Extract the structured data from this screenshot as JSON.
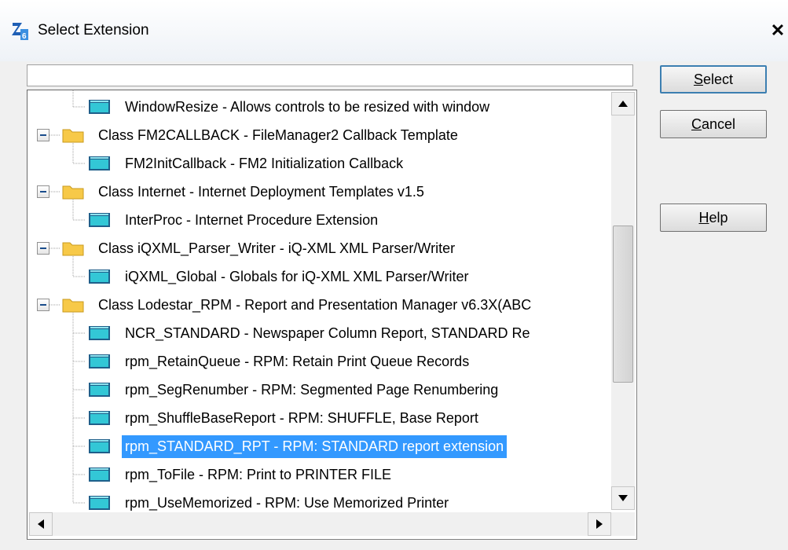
{
  "window": {
    "title": "Select Extension",
    "close_glyph": "✕"
  },
  "filter": {
    "value": ""
  },
  "tree": {
    "items": [
      {
        "type": "extension",
        "level": 1,
        "label": "WindowResize - Allows controls to be resized with window"
      },
      {
        "type": "class",
        "level": 0,
        "expanded": true,
        "label": "Class FM2CALLBACK - FileManager2 Callback Template"
      },
      {
        "type": "extension",
        "level": 1,
        "label": "FM2InitCallback - FM2 Initialization Callback"
      },
      {
        "type": "class",
        "level": 0,
        "expanded": true,
        "label": "Class Internet - Internet Deployment Templates v1.5"
      },
      {
        "type": "extension",
        "level": 1,
        "label": "InterProc - Internet Procedure Extension"
      },
      {
        "type": "class",
        "level": 0,
        "expanded": true,
        "label": "Class iQXML_Parser_Writer - iQ-XML XML Parser/Writer"
      },
      {
        "type": "extension",
        "level": 1,
        "label": "iQXML_Global - Globals for iQ-XML XML Parser/Writer"
      },
      {
        "type": "class",
        "level": 0,
        "expanded": true,
        "label": "Class Lodestar_RPM - Report and Presentation Manager v6.3X(ABC"
      },
      {
        "type": "extension",
        "level": 1,
        "label": "NCR_STANDARD - Newspaper Column Report, STANDARD Re"
      },
      {
        "type": "extension",
        "level": 1,
        "label": "rpm_RetainQueue - RPM: Retain Print Queue Records"
      },
      {
        "type": "extension",
        "level": 1,
        "label": "rpm_SegRenumber - RPM: Segmented Page Renumbering"
      },
      {
        "type": "extension",
        "level": 1,
        "label": "rpm_ShuffleBaseReport - RPM: SHUFFLE, Base Report"
      },
      {
        "type": "extension",
        "level": 1,
        "selected": true,
        "label": "rpm_STANDARD_RPT - RPM: STANDARD report extension"
      },
      {
        "type": "extension",
        "level": 1,
        "label": "rpm_ToFile - RPM: Print to PRINTER FILE"
      },
      {
        "type": "extension",
        "level": 1,
        "label": "rpm_UseMemorized - RPM: Use Memorized Printer"
      }
    ]
  },
  "buttons": {
    "select": {
      "accel": "S",
      "rest": "elect"
    },
    "cancel": {
      "accel": "C",
      "rest": "ancel"
    },
    "help": {
      "accel": "H",
      "rest": "elp"
    }
  },
  "colors": {
    "selection": "#3399ff",
    "folder": "#f7c948",
    "extension_icon": "#33c7d6"
  },
  "icons": {
    "app": "app-icon",
    "class_node": "folder-icon",
    "extension_node": "extension-icon"
  }
}
